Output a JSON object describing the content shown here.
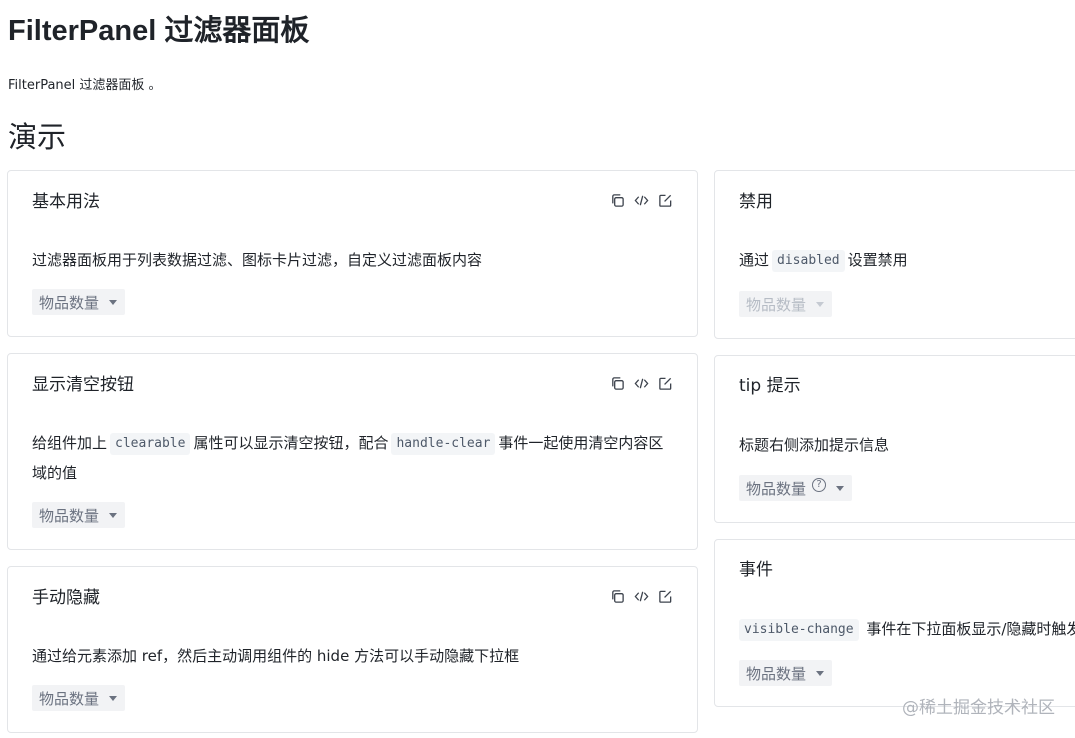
{
  "page": {
    "title": "FilterPanel 过滤器面板",
    "description": "FilterPanel 过滤器面板 。",
    "section_title": "演示"
  },
  "filter_label": "物品数量",
  "cards": {
    "basic": {
      "title": "基本用法",
      "desc": "过滤器面板用于列表数据过滤、图标卡片过滤，自定义过滤面板内容"
    },
    "clearable": {
      "title": "显示清空按钮",
      "desc_1": "给组件加上",
      "code_1": "clearable",
      "desc_2": "属性可以显示清空按钮，配合",
      "code_2": "handle-clear",
      "desc_3": "事件一起使用清空内容区域的值"
    },
    "manual_hide": {
      "title": "手动隐藏",
      "desc": "通过给元素添加 ref，然后主动调用组件的 hide 方法可以手动隐藏下拉框"
    },
    "disabled": {
      "title": "禁用",
      "desc_1": "通过",
      "code_1": "disabled",
      "desc_2": "设置禁用"
    },
    "tip": {
      "title": "tip 提示",
      "desc": "标题右侧添加提示信息",
      "help_glyph": "?"
    },
    "events": {
      "title": "事件",
      "code_1": "visible-change",
      "desc_1": "事件在下拉面板显示/隐藏时触发"
    }
  },
  "watermark": "@稀土掘金技术社区",
  "icons": {
    "copy": "copy-icon",
    "code": "code-icon",
    "edit": "edit-icon",
    "caret": "caret-down-icon",
    "help": "help-circle-icon"
  },
  "colors": {
    "border": "#e3e5e8",
    "code_bg": "#f3f5f7",
    "trigger_bg": "#f2f3f5",
    "text": "#1f2329",
    "muted": "#6b7280"
  }
}
